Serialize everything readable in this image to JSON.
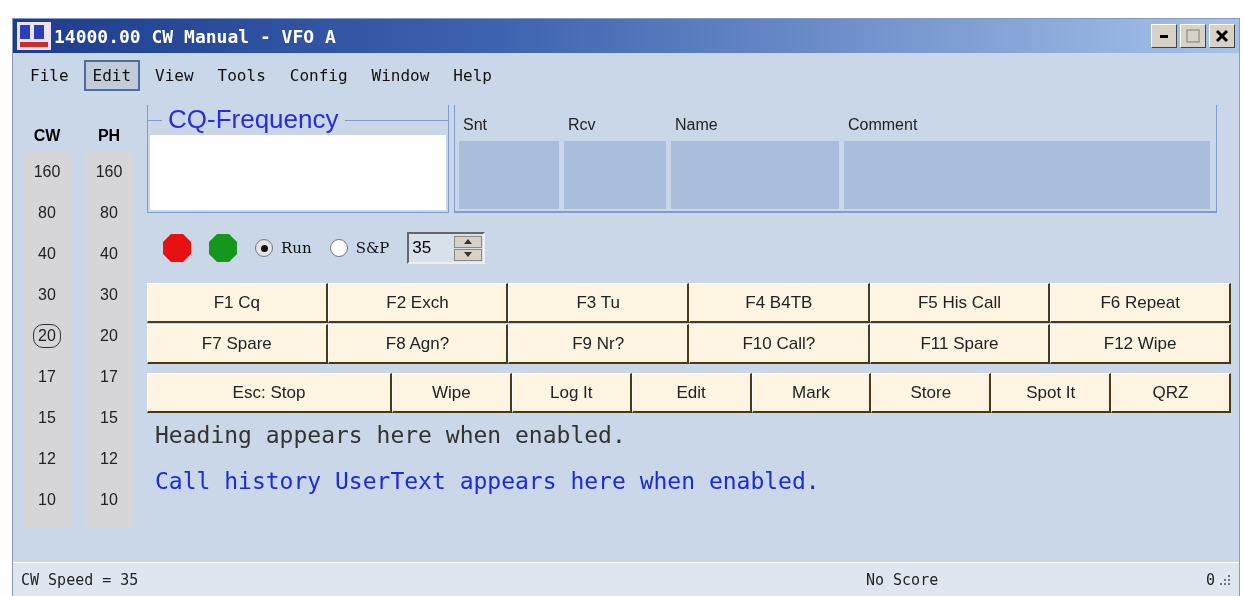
{
  "window": {
    "title": "14000.00 CW Manual - VFO A"
  },
  "menu": [
    {
      "label": "File",
      "selected": false
    },
    {
      "label": "Edit",
      "selected": true
    },
    {
      "label": "View",
      "selected": false
    },
    {
      "label": "Tools",
      "selected": false
    },
    {
      "label": "Config",
      "selected": false
    },
    {
      "label": "Window",
      "selected": false
    },
    {
      "label": "Help",
      "selected": false
    }
  ],
  "bands": [
    {
      "heading": "CW",
      "items": [
        {
          "label": "160",
          "selected": false
        },
        {
          "label": "80",
          "selected": false
        },
        {
          "label": "40",
          "selected": false
        },
        {
          "label": "30",
          "selected": false
        },
        {
          "label": "20",
          "selected": true
        },
        {
          "label": "17",
          "selected": false
        },
        {
          "label": "15",
          "selected": false
        },
        {
          "label": "12",
          "selected": false
        },
        {
          "label": "10",
          "selected": false
        }
      ]
    },
    {
      "heading": "PH",
      "items": [
        {
          "label": "160",
          "selected": false
        },
        {
          "label": "80",
          "selected": false
        },
        {
          "label": "40",
          "selected": false
        },
        {
          "label": "30",
          "selected": false
        },
        {
          "label": "20",
          "selected": false
        },
        {
          "label": "17",
          "selected": false
        },
        {
          "label": "15",
          "selected": false
        },
        {
          "label": "12",
          "selected": false
        },
        {
          "label": "10",
          "selected": false
        }
      ]
    }
  ],
  "cq_frequency": {
    "label": "CQ-Frequency"
  },
  "entry_fields": [
    {
      "label": "Snt"
    },
    {
      "label": "Rcv"
    },
    {
      "label": "Name"
    },
    {
      "label": "Comment"
    }
  ],
  "indicators": [
    {
      "color": "#e81010"
    },
    {
      "color": "#16961a"
    }
  ],
  "mode": [
    {
      "label": "Run",
      "selected": true
    },
    {
      "label": "S&P",
      "selected": false
    }
  ],
  "speed": {
    "value": "35"
  },
  "function_keys": [
    [
      "F1 Cq",
      "F2 Exch",
      "F3 Tu",
      "F4 B4TB",
      "F5 His Call",
      "F6 Repeat"
    ],
    [
      "F7 Spare",
      "F8 Agn?",
      "F9 Nr?",
      "F10 Call?",
      "F11 Spare",
      "F12 Wipe"
    ],
    [
      "Esc: Stop",
      "Wipe",
      "Log It",
      "Edit",
      "Mark",
      "Store",
      "Spot It",
      "QRZ"
    ]
  ],
  "heading_text": "Heading appears here when enabled.",
  "user_text": "Call history UserText appears here when enabled.",
  "status_bar": {
    "speed": "CW Speed = 35",
    "score": "No Score",
    "count": "0"
  }
}
